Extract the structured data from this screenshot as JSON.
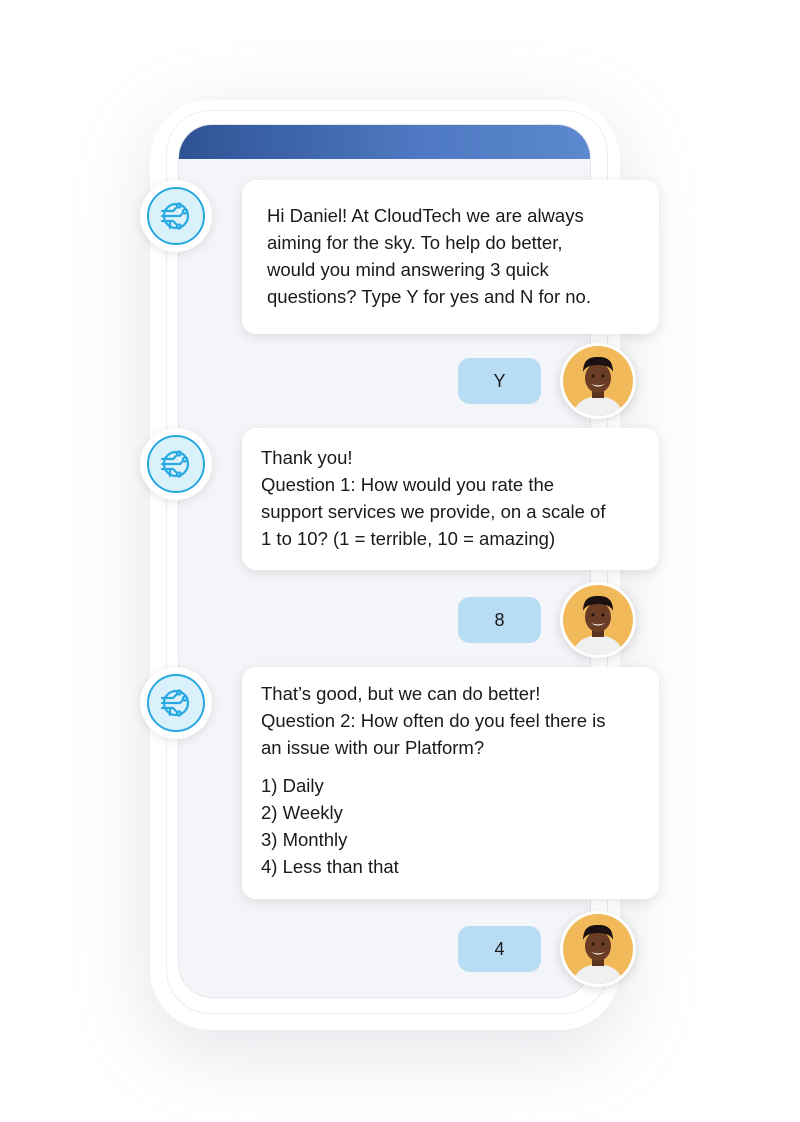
{
  "colors": {
    "header_gradient_start": "#2f5295",
    "header_gradient_end": "#5b88cf",
    "bot_ring": "#29a9e1",
    "reply_bubble": "#b8dcf3",
    "user_avatar_bg": "#f1b95a"
  },
  "icons": {
    "bot": "circuit-icon",
    "user": "user-avatar-photo"
  },
  "messages": [
    {
      "sender": "bot",
      "lines": [
        "Hi Daniel! At CloudTech we are always",
        "aiming for the sky. To help do better,",
        "would you mind answering 3 quick",
        "questions? Type Y for yes and N for no."
      ]
    },
    {
      "sender": "user",
      "text": "Y"
    },
    {
      "sender": "bot",
      "lines": [
        "Thank you!",
        "Question 1: How would you rate the",
        "support services we provide, on a scale of",
        "1 to 10? (1 = terrible, 10 = amazing)"
      ]
    },
    {
      "sender": "user",
      "text": "8"
    },
    {
      "sender": "bot",
      "lines": [
        "That’s good, but we can do better!",
        "Question 2: How often do you feel there is",
        "an issue with our Platform?"
      ],
      "options": [
        "1) Daily",
        "2) Weekly",
        "3) Monthly",
        "4) Less than that"
      ]
    },
    {
      "sender": "user",
      "text": "4"
    }
  ]
}
